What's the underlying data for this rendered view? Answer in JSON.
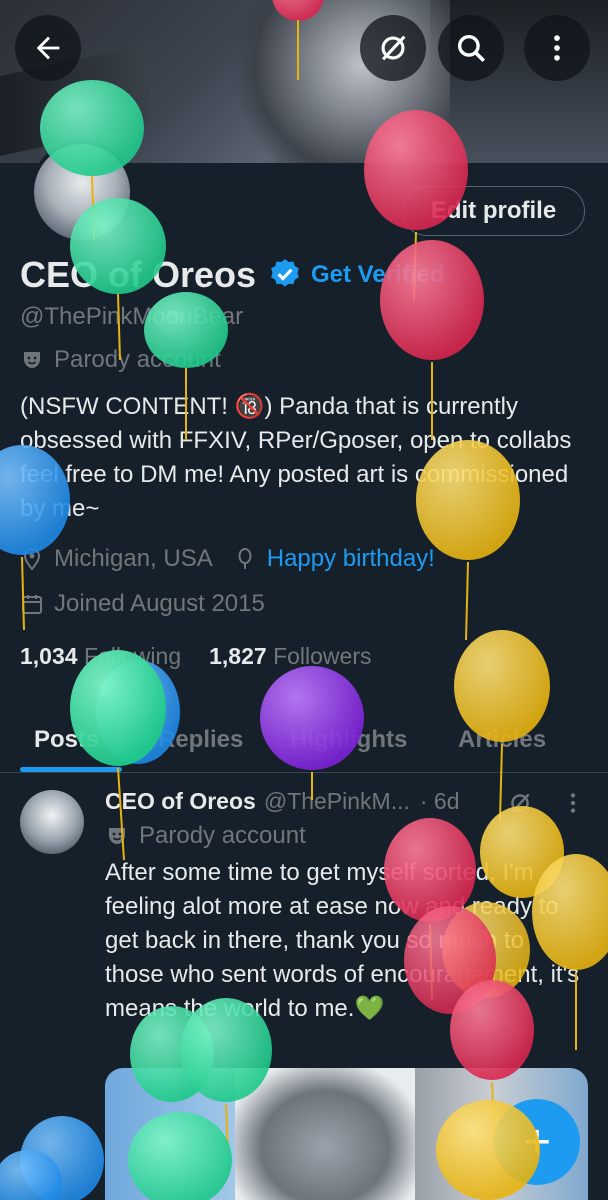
{
  "header": {
    "back_icon": "arrow-left-icon",
    "grok_icon": "grok-slash-icon",
    "search_icon": "search-icon",
    "more_icon": "more-vertical-icon"
  },
  "profile": {
    "edit_profile_label": "Edit profile",
    "display_name": "CEO of Oreos",
    "get_verified_label": "Get Verified",
    "handle": "@ThePinkMoonBear",
    "parody_label": "Parody account",
    "bio": "(NSFW CONTENT! 🔞) Panda that is currently obsessed with FFXIV, RPer/Gposer, open to collabs feel free to DM me! Any posted art is commissioned by me~",
    "location": "Michigan, USA",
    "birthday_label": "Happy birthday!",
    "joined": "Joined August 2015",
    "following_count": "1,034",
    "following_label": "Following",
    "followers_count": "1,827",
    "followers_label": "Followers"
  },
  "tabs": [
    {
      "label": "Posts",
      "active": true
    },
    {
      "label": "Replies",
      "active": false
    },
    {
      "label": "Highlights",
      "active": false
    },
    {
      "label": "Articles",
      "active": false
    }
  ],
  "post": {
    "name": "CEO of Oreos",
    "handle": "@ThePinkM...",
    "time": "· 6d",
    "parody_label": "Parody account",
    "text": "After some time to get myself sorted, I'm feeling alot more at ease now and ready to get back in there, thank you so much to those who sent words of encouragement, it's means the world to me.💚"
  },
  "fab_label": "+",
  "colors": {
    "background": "#15202b",
    "accent": "#1d9bf0",
    "text_primary": "#e7e9ea",
    "text_secondary": "#71767b",
    "balloon_green": "#2bd99a",
    "balloon_red": "#e8355c",
    "balloon_yellow": "#f5c518",
    "balloon_blue": "#2f9ef0",
    "balloon_purple": "#8a2be2"
  }
}
